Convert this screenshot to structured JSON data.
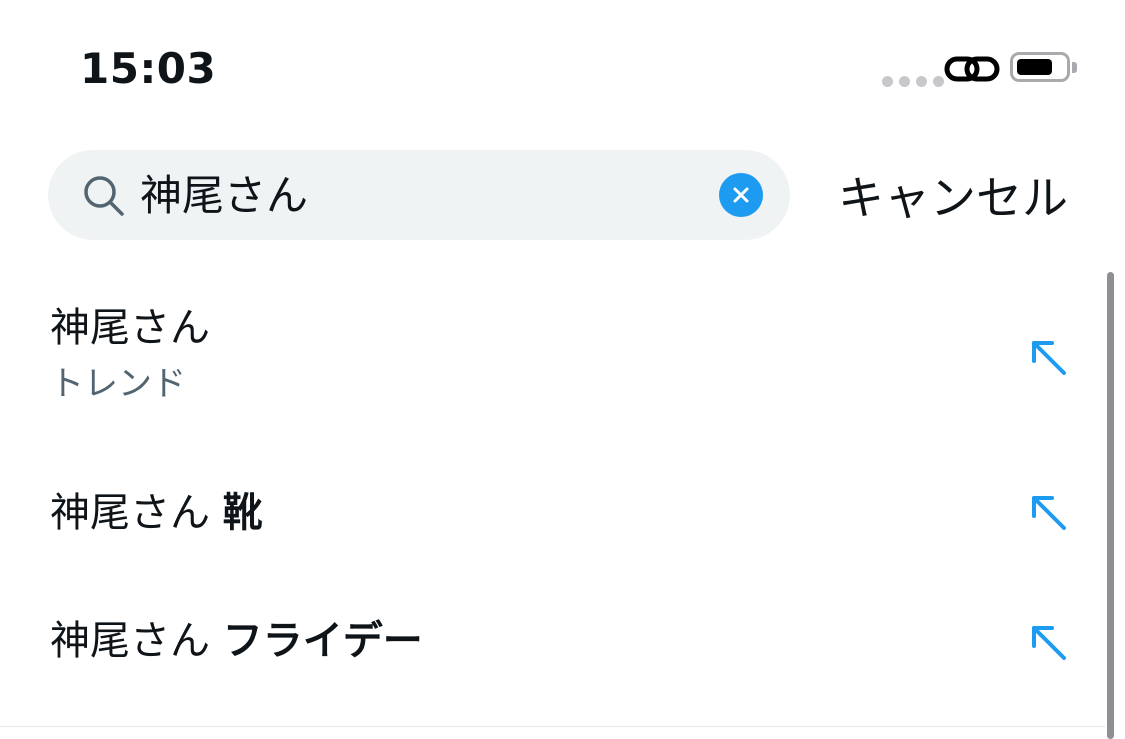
{
  "status_bar": {
    "time": "15:03",
    "battery_level": 0.75
  },
  "search": {
    "query": "神尾さん",
    "cancel_label": "キャンセル"
  },
  "suggestions": [
    {
      "query": "神尾さん",
      "bold_suffix": "",
      "subtitle": "トレンド"
    },
    {
      "query": "神尾さん",
      "bold_suffix": "靴",
      "subtitle": ""
    },
    {
      "query": "神尾さん",
      "bold_suffix": "フライデー",
      "subtitle": ""
    }
  ],
  "colors": {
    "accent": "#1d9bf0",
    "text_primary": "#0f1419",
    "text_secondary": "#536471",
    "search_background": "#eff3f4"
  },
  "icons": {
    "search": "search-icon",
    "clear": "clear-icon",
    "suggestion_arrow": "arrow-up-left-icon",
    "connection": "link-icon",
    "battery": "battery-icon"
  }
}
